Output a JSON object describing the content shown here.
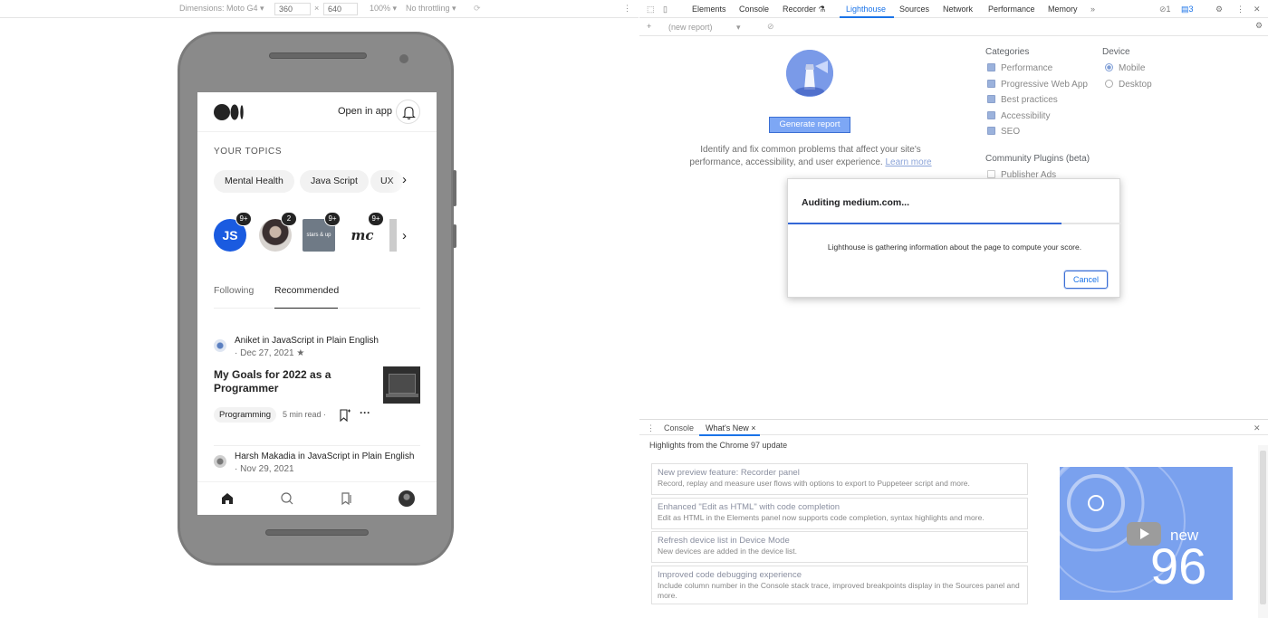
{
  "device_toolbar": {
    "dimensions_label": "Dimensions: Moto G4 ▾",
    "width": "360",
    "times": "×",
    "height": "640",
    "zoom": "100% ▾",
    "throttling": "No throttling ▾"
  },
  "medium": {
    "open_in_app": "Open in app",
    "topics_label": "YOUR TOPICS",
    "topics": [
      "Mental Health",
      "Java Script",
      "UX"
    ],
    "avatars": [
      {
        "label": "JS",
        "badge": "9+",
        "color": "#1a5be0"
      },
      {
        "label": "",
        "badge": "2",
        "color": "#8b7b78"
      },
      {
        "label": "stars & up",
        "badge": "9+",
        "color": "#6f7a86"
      },
      {
        "label": "mc",
        "badge": "9+",
        "color": "#ffffff"
      }
    ],
    "tabs": [
      "Following",
      "Recommended"
    ],
    "posts": [
      {
        "author": "Aniket in JavaScript in Plain English",
        "date": "· Dec 27, 2021 ★",
        "title": "My Goals for 2022 as a Programmer",
        "tag": "Programming",
        "read_time": "5 min read ·"
      },
      {
        "author": "Harsh Makadia in JavaScript in Plain English",
        "date": "· Nov 29, 2021"
      }
    ]
  },
  "devtools": {
    "tabs": [
      "Elements",
      "Console",
      "Recorder ⚗",
      "Lighthouse",
      "Sources",
      "Network",
      "Performance",
      "Memory",
      "»"
    ],
    "errors": "1",
    "messages": "3",
    "report_placeholder": "(new report)",
    "lighthouse": {
      "generate_button": "Generate report",
      "description": "Identify and fix common problems that affect your site's performance, accessibility, and user experience.",
      "learn_more": "Learn more",
      "categories_label": "Categories",
      "categories": [
        "Performance",
        "Progressive Web App",
        "Best practices",
        "Accessibility",
        "SEO"
      ],
      "device_label": "Device",
      "devices": [
        "Mobile",
        "Desktop"
      ],
      "plugins_label": "Community Plugins (beta)",
      "plugins": [
        "Publisher Ads"
      ]
    },
    "dialog": {
      "title": "Auditing medium.com...",
      "message": "Lighthouse is gathering information about the page to compute your score.",
      "cancel": "Cancel",
      "progress": 0.82
    },
    "drawer": {
      "tabs": [
        "Console",
        "What's New ×"
      ],
      "headline": "Highlights from the Chrome 97 update",
      "items": [
        {
          "title": "New preview feature: Recorder panel",
          "desc": "Record, replay and measure user flows with options to export to Puppeteer script and more."
        },
        {
          "title": "Enhanced \"Edit as HTML\" with code completion",
          "desc": "Edit as HTML in the Elements panel now supports code completion, syntax highlights and more."
        },
        {
          "title": "Refresh device list in Device Mode",
          "desc": "New devices are added in the device list."
        },
        {
          "title": "Improved code debugging experience",
          "desc": "Include column number in the Console stack trace, improved breakpoints display in the Sources panel and more."
        }
      ],
      "video_new": "new",
      "video_version": "96"
    }
  }
}
